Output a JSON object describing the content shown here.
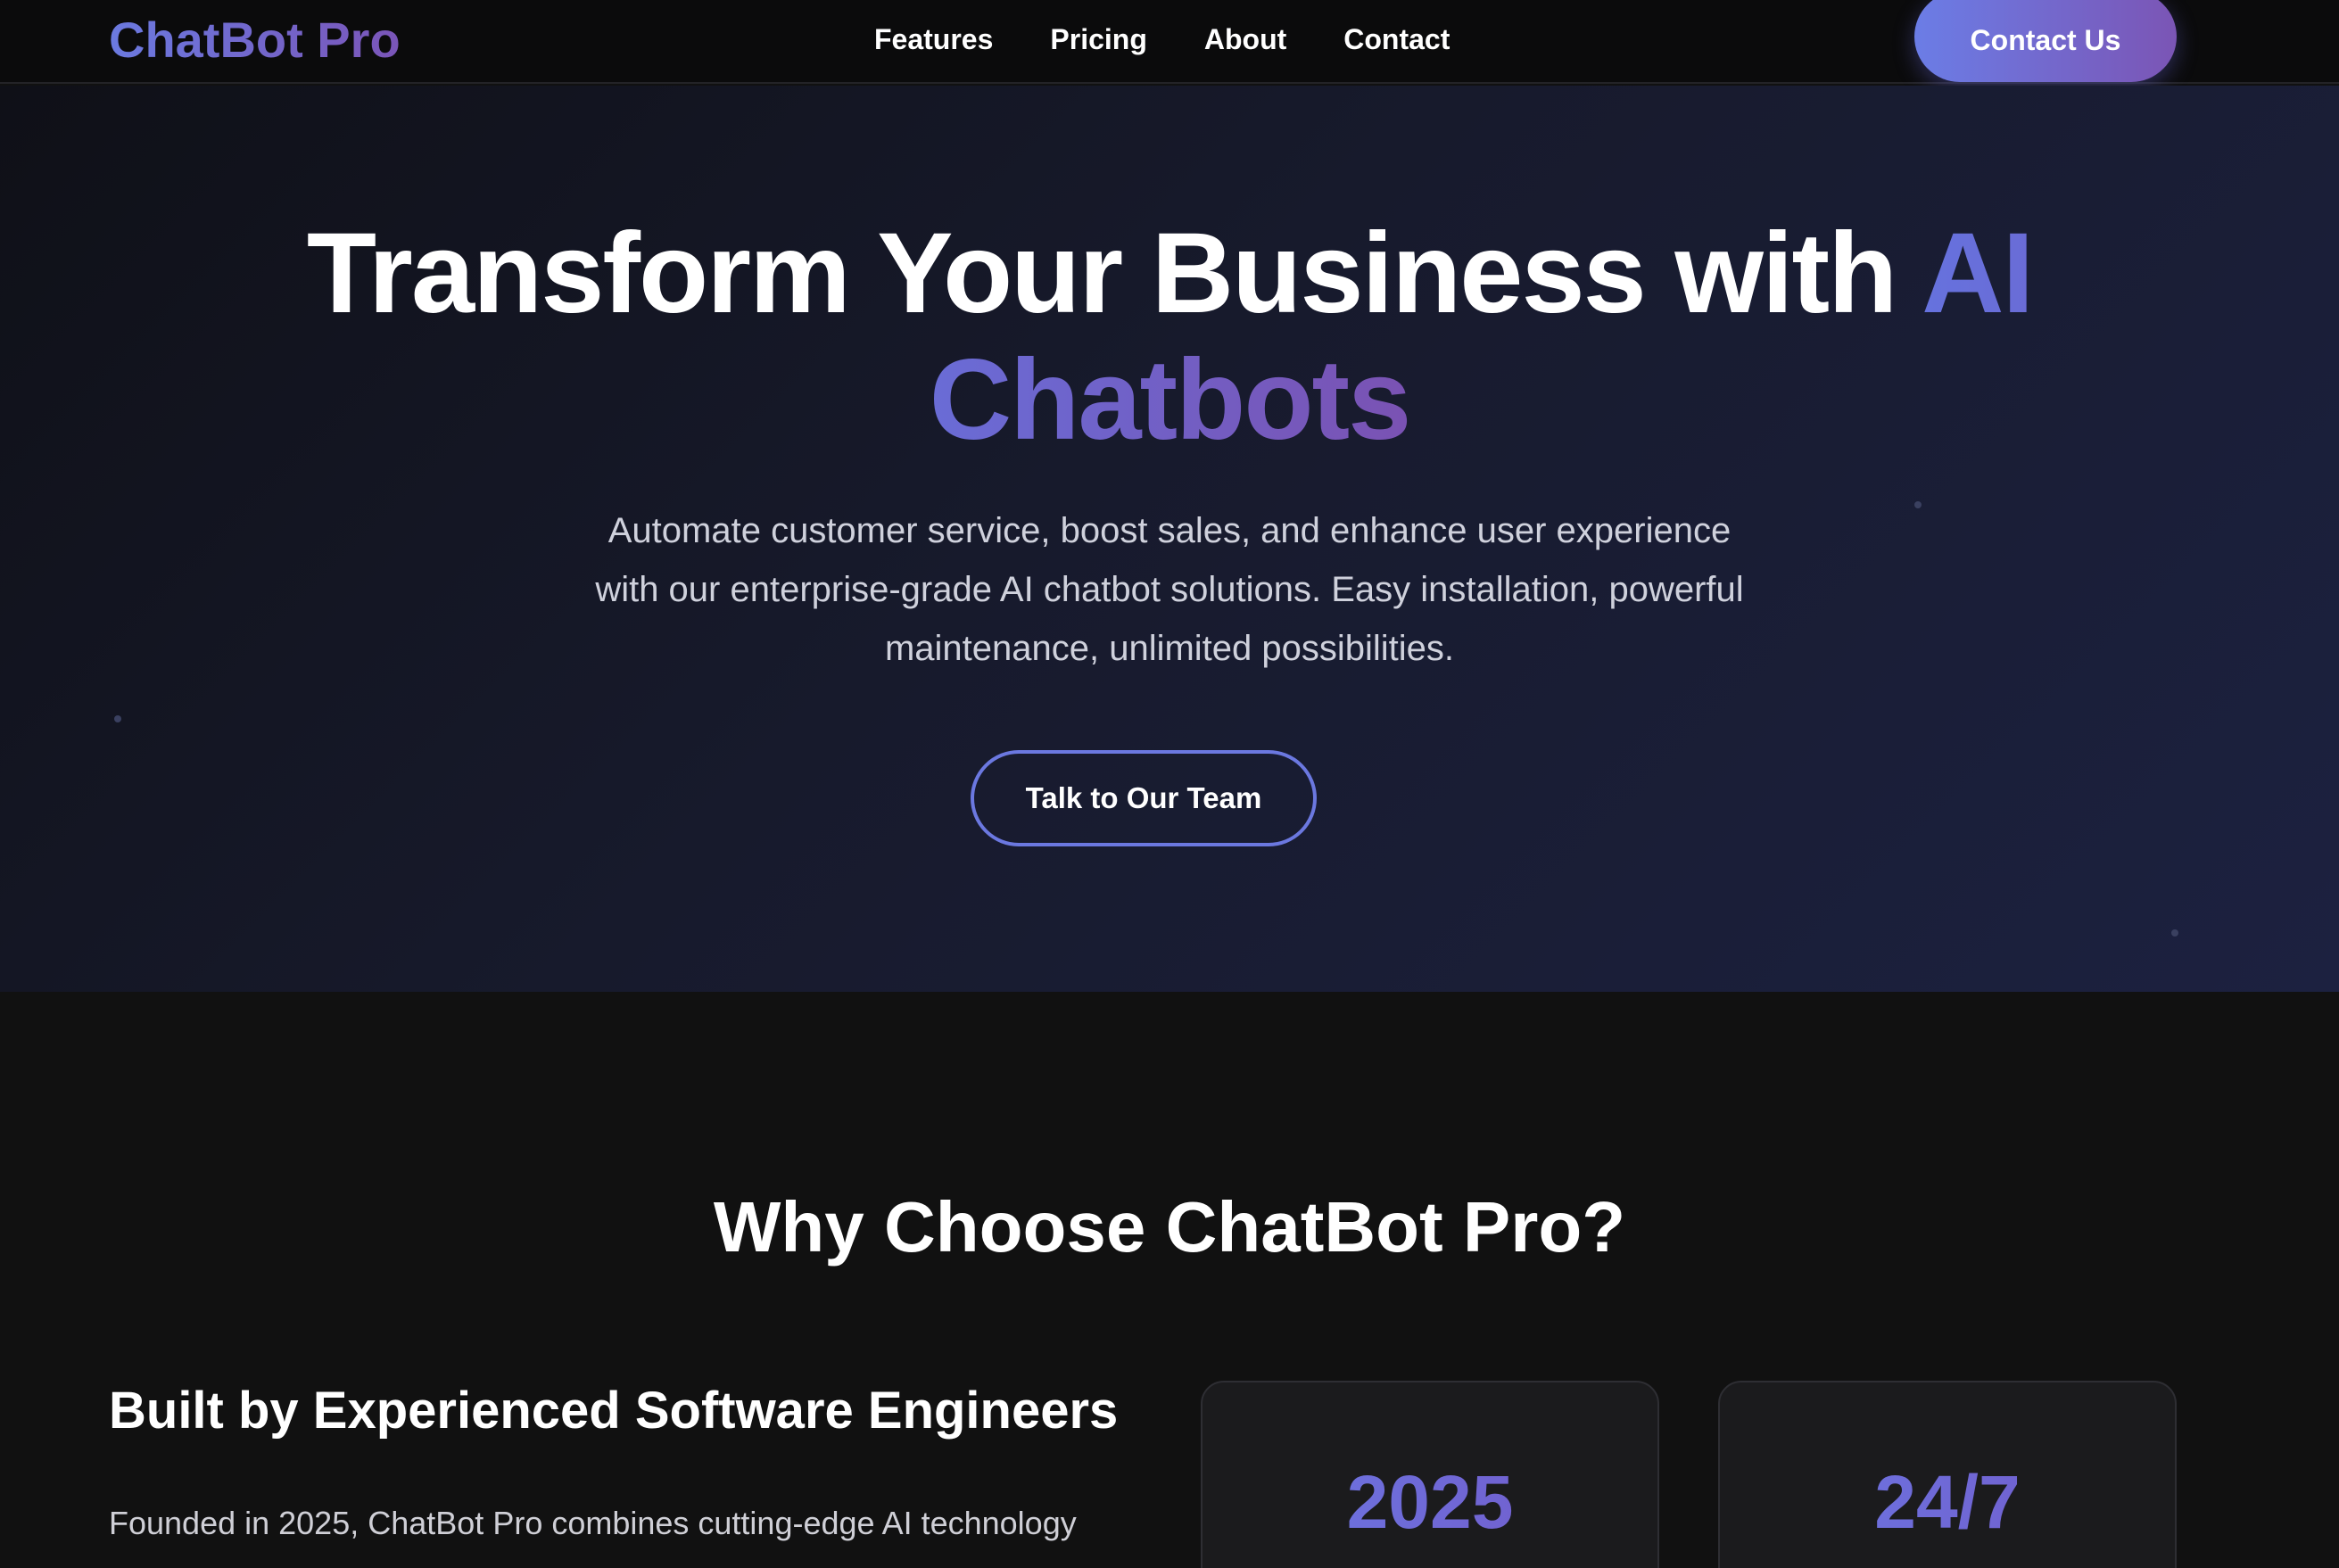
{
  "nav": {
    "logo": "ChatBot Pro",
    "links": [
      "Features",
      "Pricing",
      "About",
      "Contact"
    ],
    "cta": "Contact Us"
  },
  "hero": {
    "title_main": "Transform Your Business with ",
    "title_accent": "AI Chatbots",
    "subtitle": "Automate customer service, boost sales, and enhance user experience with our enterprise-grade AI chatbot solutions. Easy installation, powerful maintenance, unlimited possibilities.",
    "button": "Talk to Our Team"
  },
  "why": {
    "title": "Why Choose ChatBot Pro?",
    "heading": "Built by Experienced Software Engineers",
    "body": "Founded in 2025, ChatBot Pro combines cutting-edge AI technology",
    "stats": [
      {
        "value": "2025"
      },
      {
        "value": "24/7"
      }
    ]
  },
  "colors": {
    "accent_start": "#6b7ae0",
    "accent_end": "#7a52b3",
    "background": "#111111"
  }
}
